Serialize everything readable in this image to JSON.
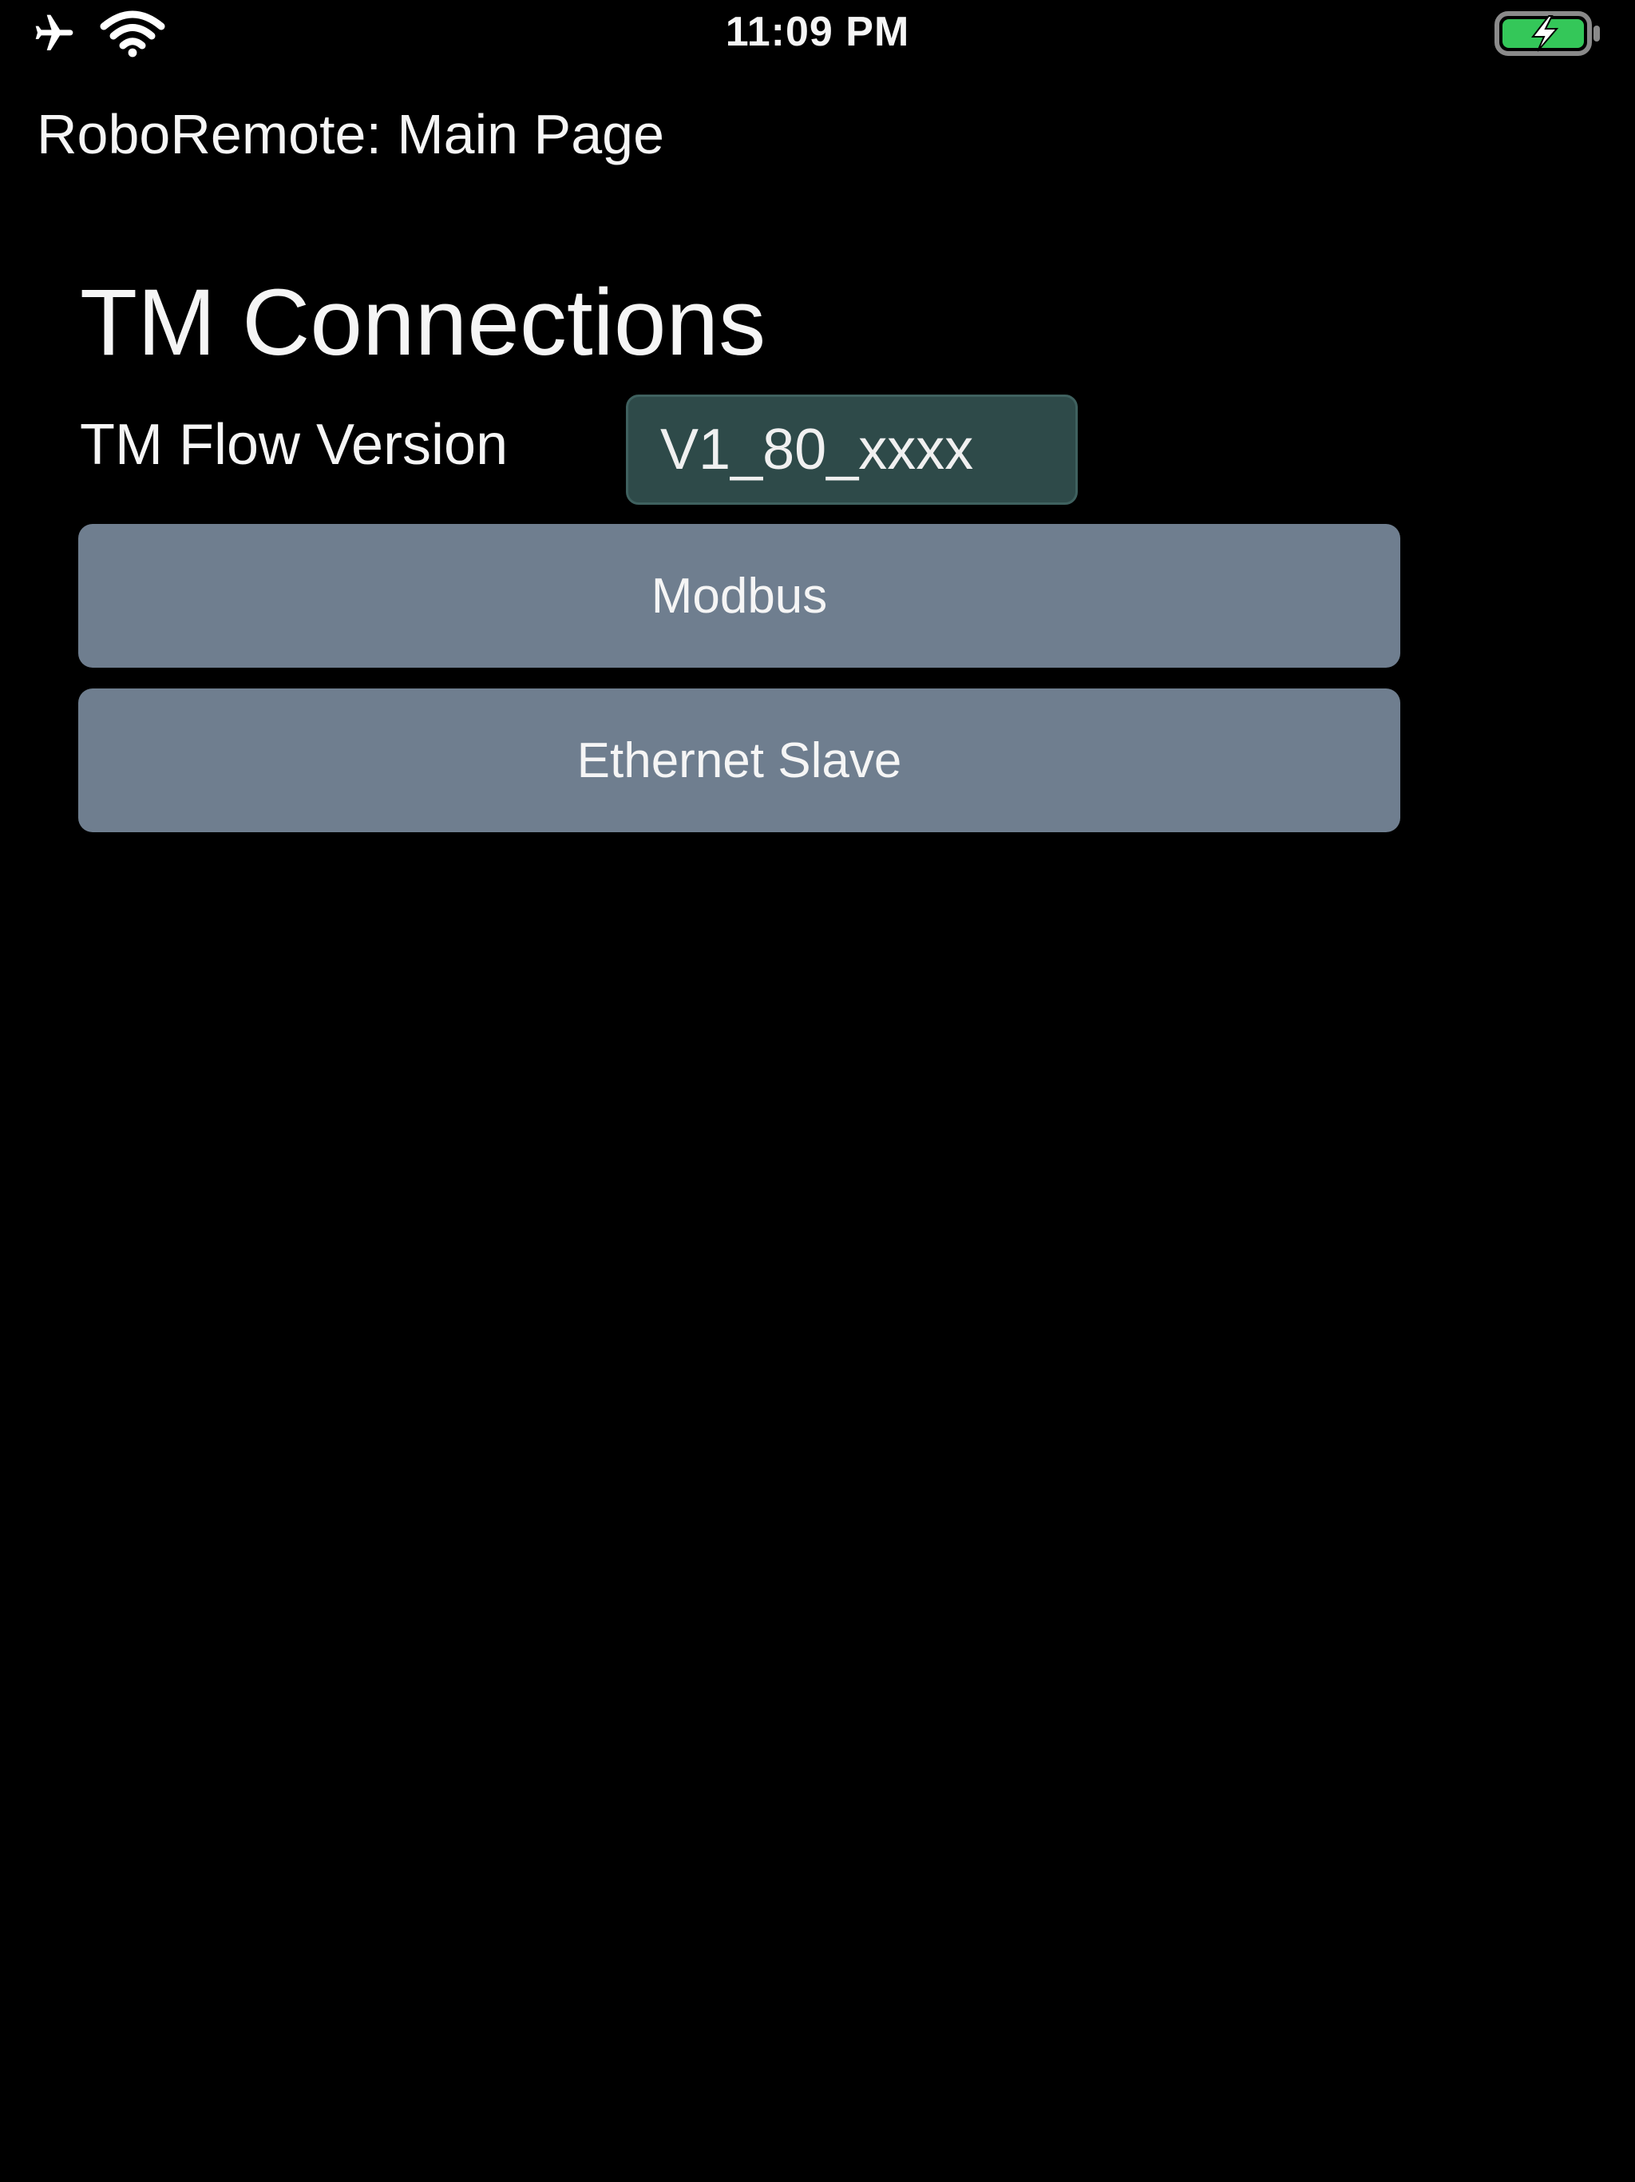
{
  "status_bar": {
    "time": "11:09 PM",
    "left_icons": [
      "airplane-icon",
      "wifi-icon"
    ],
    "right_icons": [
      "battery-charging-icon"
    ],
    "battery_color": "#34c759"
  },
  "header": {
    "title": "RoboRemote: Main Page"
  },
  "main": {
    "section_title": "TM Connections",
    "version_label": "TM Flow Version",
    "version_value": "V1_80_xxxx",
    "buttons": [
      {
        "label": "Modbus"
      },
      {
        "label": "Ethernet Slave"
      }
    ]
  },
  "colors": {
    "background": "#000000",
    "button": "#6f7e8f",
    "field": "#2e4a49",
    "text": "#f5f5f5"
  }
}
